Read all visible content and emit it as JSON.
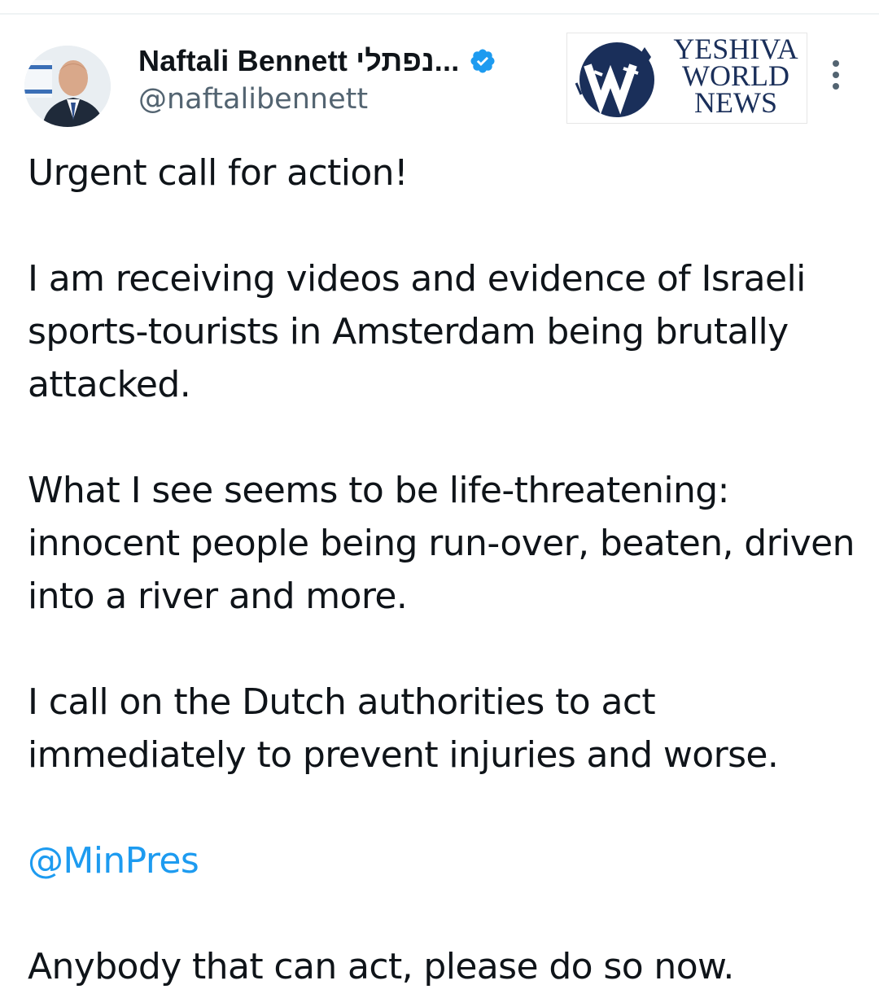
{
  "header": {
    "display_name": "Naftali Bennett נפתלי...",
    "handle": "@naftalibennett",
    "verified_icon": "verified-badge-icon",
    "more_icon": "more-options-icon",
    "accent_color": "#1d9bf0"
  },
  "watermark": {
    "line1": "YESHIVA",
    "line2": "WORLD",
    "line3": "NEWS",
    "color": "#1a2f5a"
  },
  "tweet": {
    "p1": "Urgent call for action!",
    "p2": "I am receiving videos and evidence of Israeli sports-tourists in Amsterdam being brutally attacked.",
    "p3": "What I see seems to be life-threatening: innocent people being run-over, beaten, driven into a river and more.",
    "p4": "I call on the Dutch authorities to act immediately to prevent injuries and worse.",
    "mention": "@MinPres",
    "p5": "Anybody that can act, please do so now."
  }
}
